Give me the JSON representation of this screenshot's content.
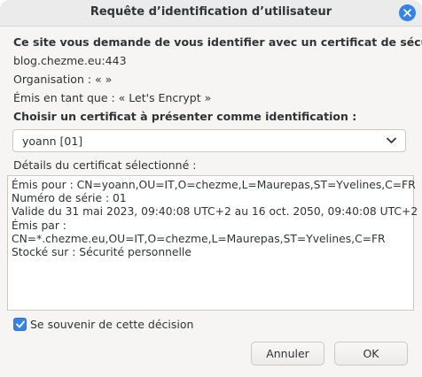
{
  "window": {
    "title": "Requête d’identification d’utilisateur"
  },
  "header": {
    "intro": "Ce site vous demande de vous identifier avec un certificat de sécurité :",
    "host": "blog.chezme.eu:443",
    "organization": "Organisation : «  »",
    "issuer": "Émis en tant que : « Let's Encrypt »"
  },
  "chooser": {
    "label": "Choisir un certificat à présenter comme identification :",
    "selected": "yoann [01]"
  },
  "details": {
    "label": "Détails du certificat sélectionné :",
    "lines": [
      "Émis pour : CN=yoann,OU=IT,O=chezme,L=Maurepas,ST=Yvelines,C=FR",
      "Numéro de série : 01",
      "Valide du 31 mai 2023, 09:40:08 UTC+2 au 16 oct. 2050, 09:40:08 UTC+2",
      "Émis par :",
      "CN=*.chezme.eu,OU=IT,O=chezme,L=Maurepas,ST=Yvelines,C=FR",
      "Stocké sur : Sécurité personnelle"
    ]
  },
  "remember": {
    "label": "Se souvenir de cette décision",
    "checked": true
  },
  "buttons": {
    "cancel": "Annuler",
    "ok": "OK"
  },
  "icons": {
    "close": "close-icon",
    "dropdown": "chevron-down-icon",
    "check": "checkmark-icon"
  },
  "colors": {
    "accent": "#3584e4",
    "background": "#f6f5f4",
    "text": "#2e3436"
  }
}
